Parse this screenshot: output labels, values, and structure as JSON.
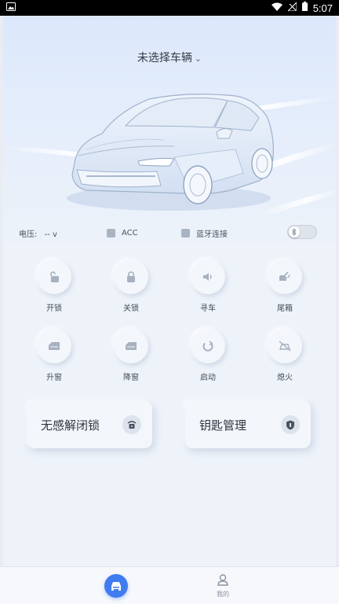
{
  "status_bar": {
    "time": "5:07"
  },
  "header": {
    "vehicle_selector": "未选择车辆"
  },
  "status": {
    "voltage_label": "电压:",
    "voltage_value": "-- v",
    "acc_label": "ACC",
    "bluetooth_label": "蓝牙连接"
  },
  "controls": [
    {
      "label": "开锁",
      "icon": "unlock-icon"
    },
    {
      "label": "关锁",
      "icon": "lock-icon"
    },
    {
      "label": "寻车",
      "icon": "speaker-icon"
    },
    {
      "label": "尾箱",
      "icon": "trunk-icon"
    },
    {
      "label": "升窗",
      "icon": "window-up-icon"
    },
    {
      "label": "降窗",
      "icon": "window-down-icon"
    },
    {
      "label": "启动",
      "icon": "power-start-icon"
    },
    {
      "label": "熄火",
      "icon": "engine-off-icon"
    }
  ],
  "cards": {
    "keyless_label": "无感解闭锁",
    "key_mgmt_label": "钥匙管理"
  },
  "tabbar": {
    "mine_label": "我的"
  },
  "colors": {
    "accent": "#3f7cf0",
    "icon_gray": "#a7b1bf",
    "background": "#eef3fa"
  }
}
